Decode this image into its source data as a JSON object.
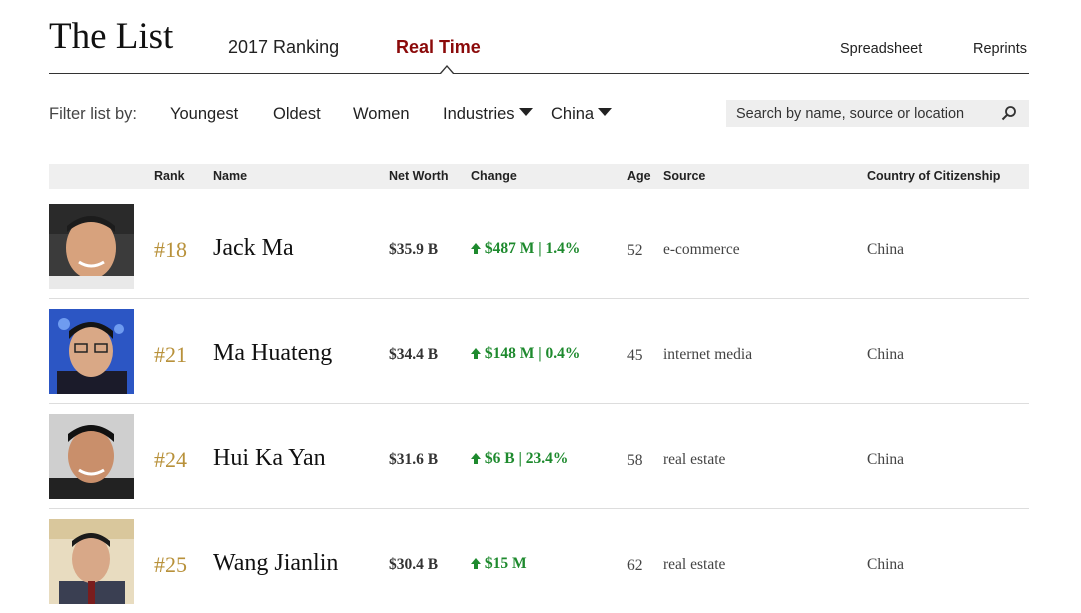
{
  "header": {
    "title": "The List",
    "tabs": [
      {
        "label": "2017 Ranking",
        "active": false
      },
      {
        "label": "Real Time",
        "active": true
      }
    ],
    "links": {
      "spreadsheet": "Spreadsheet",
      "reprints": "Reprints"
    }
  },
  "filters": {
    "label": "Filter list by:",
    "items": [
      "Youngest",
      "Oldest",
      "Women"
    ],
    "industries": "Industries",
    "country": "China",
    "search_placeholder": "Search by name, source or location"
  },
  "table": {
    "columns": {
      "rank": "Rank",
      "name": "Name",
      "net_worth": "Net Worth",
      "change": "Change",
      "age": "Age",
      "source": "Source",
      "country": "Country of Citizenship"
    },
    "rows": [
      {
        "rank": "#18",
        "name": "Jack Ma",
        "net_worth": "$35.9 B",
        "change": "$487 M | 1.4%",
        "age": "52",
        "source": "e-commerce",
        "country": "China"
      },
      {
        "rank": "#21",
        "name": "Ma Huateng",
        "net_worth": "$34.4 B",
        "change": "$148 M | 0.4%",
        "age": "45",
        "source": "internet media",
        "country": "China"
      },
      {
        "rank": "#24",
        "name": "Hui Ka Yan",
        "net_worth": "$31.6 B",
        "change": "$6 B | 23.4%",
        "age": "58",
        "source": "real estate",
        "country": "China"
      },
      {
        "rank": "#25",
        "name": "Wang Jianlin",
        "net_worth": "$30.4 B",
        "change": "$15 M",
        "age": "62",
        "source": "real estate",
        "country": "China"
      }
    ]
  },
  "colors": {
    "active_tab": "#8b0a0a",
    "rank": "#b8913a",
    "change_up": "#1e8a2e"
  }
}
